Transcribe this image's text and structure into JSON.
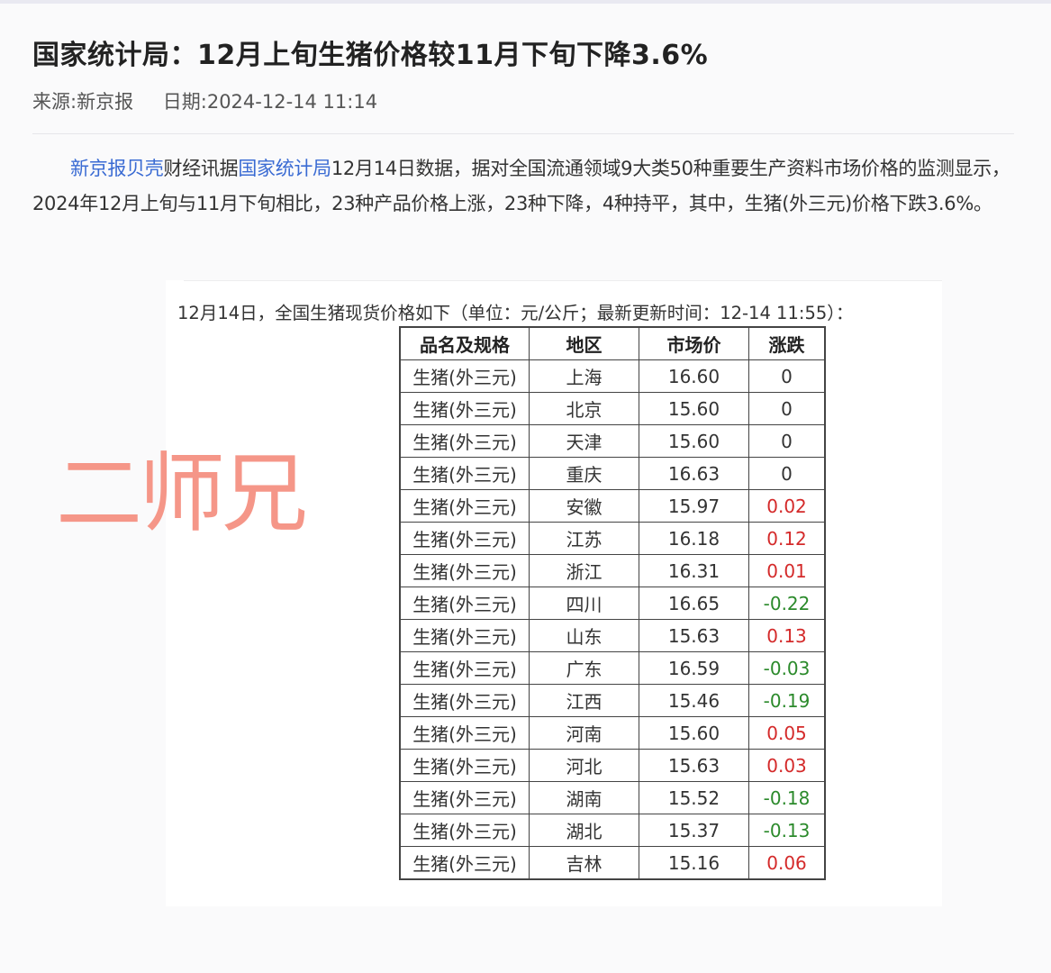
{
  "article": {
    "title": "国家统计局：12月上旬生猪价格较11月下旬下降3.6%",
    "source": "来源:新京报",
    "date": "日期:2024-12-14 11:14",
    "body": {
      "link1": "新京报贝壳",
      "text1": "财经讯据",
      "link2": "国家统计局",
      "text2": "12月14日数据，据对全国流通领域9大类50种重要生产资料市场价格的监测显示，2024年12月上旬与11月下旬相比，23种产品价格上涨，23种下降，4种持平，其中，生猪(外三元)价格下跌3.6%。"
    }
  },
  "price_table": {
    "caption": "12月14日，全国生猪现货价格如下（单位：元/公斤；最新更新时间：12-14 11:55）：",
    "headers": [
      "品名及规格",
      "地区",
      "市场价",
      "涨跌"
    ],
    "rows": [
      {
        "name": "生猪(外三元)",
        "region": "上海",
        "price": "16.60",
        "change": "0",
        "trend": "flat"
      },
      {
        "name": "生猪(外三元)",
        "region": "北京",
        "price": "15.60",
        "change": "0",
        "trend": "flat"
      },
      {
        "name": "生猪(外三元)",
        "region": "天津",
        "price": "15.60",
        "change": "0",
        "trend": "flat"
      },
      {
        "name": "生猪(外三元)",
        "region": "重庆",
        "price": "16.63",
        "change": "0",
        "trend": "flat"
      },
      {
        "name": "生猪(外三元)",
        "region": "安徽",
        "price": "15.97",
        "change": "0.02",
        "trend": "up"
      },
      {
        "name": "生猪(外三元)",
        "region": "江苏",
        "price": "16.18",
        "change": "0.12",
        "trend": "up"
      },
      {
        "name": "生猪(外三元)",
        "region": "浙江",
        "price": "16.31",
        "change": "0.01",
        "trend": "up"
      },
      {
        "name": "生猪(外三元)",
        "region": "四川",
        "price": "16.65",
        "change": "-0.22",
        "trend": "down"
      },
      {
        "name": "生猪(外三元)",
        "region": "山东",
        "price": "15.63",
        "change": "0.13",
        "trend": "up"
      },
      {
        "name": "生猪(外三元)",
        "region": "广东",
        "price": "16.59",
        "change": "-0.03",
        "trend": "down"
      },
      {
        "name": "生猪(外三元)",
        "region": "江西",
        "price": "15.46",
        "change": "-0.19",
        "trend": "down"
      },
      {
        "name": "生猪(外三元)",
        "region": "河南",
        "price": "15.60",
        "change": "0.05",
        "trend": "up"
      },
      {
        "name": "生猪(外三元)",
        "region": "河北",
        "price": "15.63",
        "change": "0.03",
        "trend": "up"
      },
      {
        "name": "生猪(外三元)",
        "region": "湖南",
        "price": "15.52",
        "change": "-0.18",
        "trend": "down"
      },
      {
        "name": "生猪(外三元)",
        "region": "湖北",
        "price": "15.37",
        "change": "-0.13",
        "trend": "down"
      },
      {
        "name": "生猪(外三元)",
        "region": "吉林",
        "price": "15.16",
        "change": "0.06",
        "trend": "up"
      }
    ]
  },
  "watermark": "二师兄",
  "colors": {
    "link": "#3a6bd3",
    "up": "#d42a2a",
    "down": "#2b8a2b",
    "watermark": "#f59688"
  }
}
